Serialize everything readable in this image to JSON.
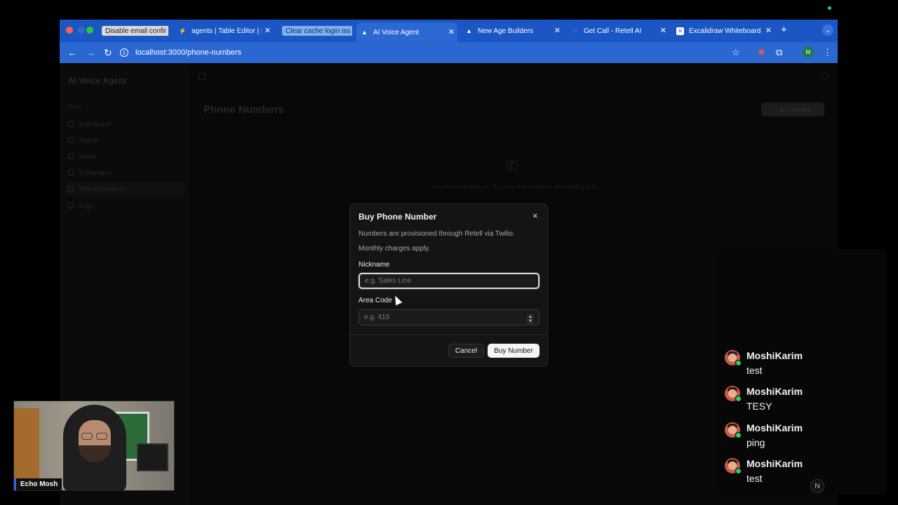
{
  "browser": {
    "tabs": [
      {
        "label": "Disable email confir",
        "style": "pill-light"
      },
      {
        "label": "agents | Table Editor | R",
        "icon": "supabase-icon"
      },
      {
        "label": "Clear cache login iss",
        "style": "pill-blue"
      },
      {
        "label": "AI Voice Agent",
        "icon": "triangle-icon",
        "active": true
      },
      {
        "label": "New Age Builders",
        "icon": "triangle-icon"
      },
      {
        "label": "Get Call - Retell AI",
        "icon": "loading-icon"
      },
      {
        "label": "Excalidraw Whiteboard",
        "icon": "excalidraw-icon"
      }
    ],
    "new_tab": "+",
    "url": "localhost:3000/phone-numbers",
    "profile_initial": "M"
  },
  "app": {
    "title": "AI Voice Agent",
    "menu_heading": "Menu",
    "sidebar": [
      {
        "label": "Dashboard"
      },
      {
        "label": "Agents"
      },
      {
        "label": "Leads"
      },
      {
        "label": "Campaigns"
      },
      {
        "label": "Phone Numbers",
        "active": true
      },
      {
        "label": "Logs"
      }
    ],
    "page_title": "Phone Numbers",
    "buy_button": "+ Buy Number",
    "empty_text": "No phone numbers yet. Buy your first number to start making calls."
  },
  "modal": {
    "title": "Buy Phone Number",
    "close": "×",
    "description": "Numbers are provisioned through Retell via Twilio. Monthly charges apply.",
    "nickname_label": "Nickname",
    "nickname_placeholder": "e.g. Sales Line",
    "area_code_label": "Area Code",
    "area_code_placeholder": "e.g. 415",
    "cancel_label": "Cancel",
    "buy_label": "Buy Number"
  },
  "chat": [
    {
      "name": "MoshiKarim",
      "text": "test"
    },
    {
      "name": "MoshiKarim",
      "text": "TESY"
    },
    {
      "name": "MoshiKarim",
      "text": "ping"
    },
    {
      "name": "MoshiKarim",
      "text": "test"
    }
  ],
  "webcam": {
    "label": "Echo Mosh"
  },
  "n_badge": "N"
}
